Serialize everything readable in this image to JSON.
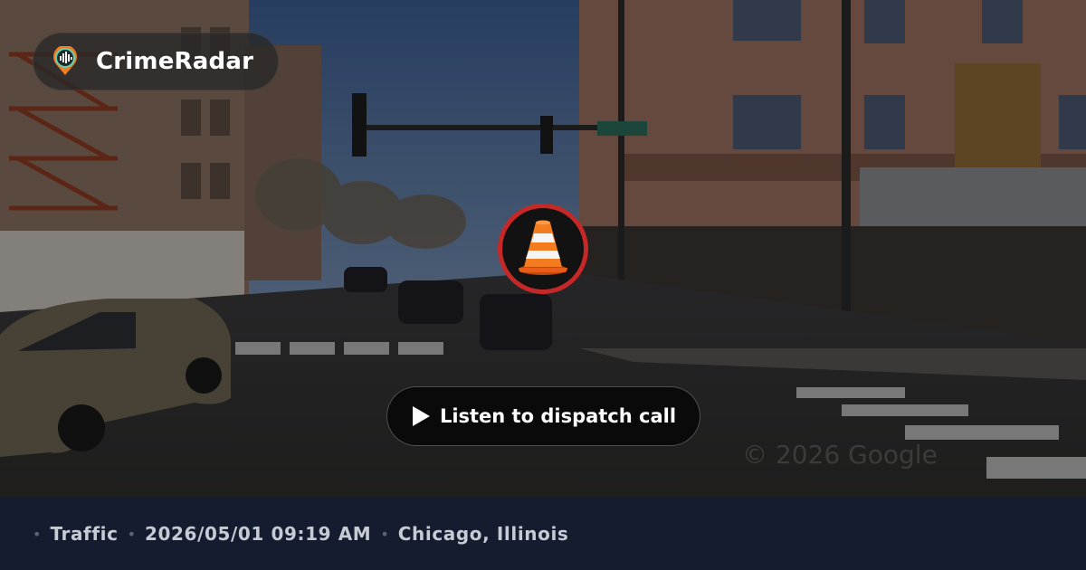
{
  "brand": {
    "name": "CrimeRadar",
    "logo_icon": "radar-pin-icon"
  },
  "incident": {
    "category_icon": "traffic-cone-icon",
    "badge_ring_color": "#c62828"
  },
  "audio": {
    "button_label": "Listen to dispatch call",
    "button_icon": "play-icon"
  },
  "meta": {
    "category": "Traffic",
    "datetime": "2026/05/01 09:19 AM",
    "location": "Chicago, Illinois"
  },
  "background": {
    "watermark": "© 2026 Google"
  },
  "colors": {
    "footer_bg": "#151c30",
    "footer_text": "#c7cbd4",
    "accent": "#f47c20"
  }
}
